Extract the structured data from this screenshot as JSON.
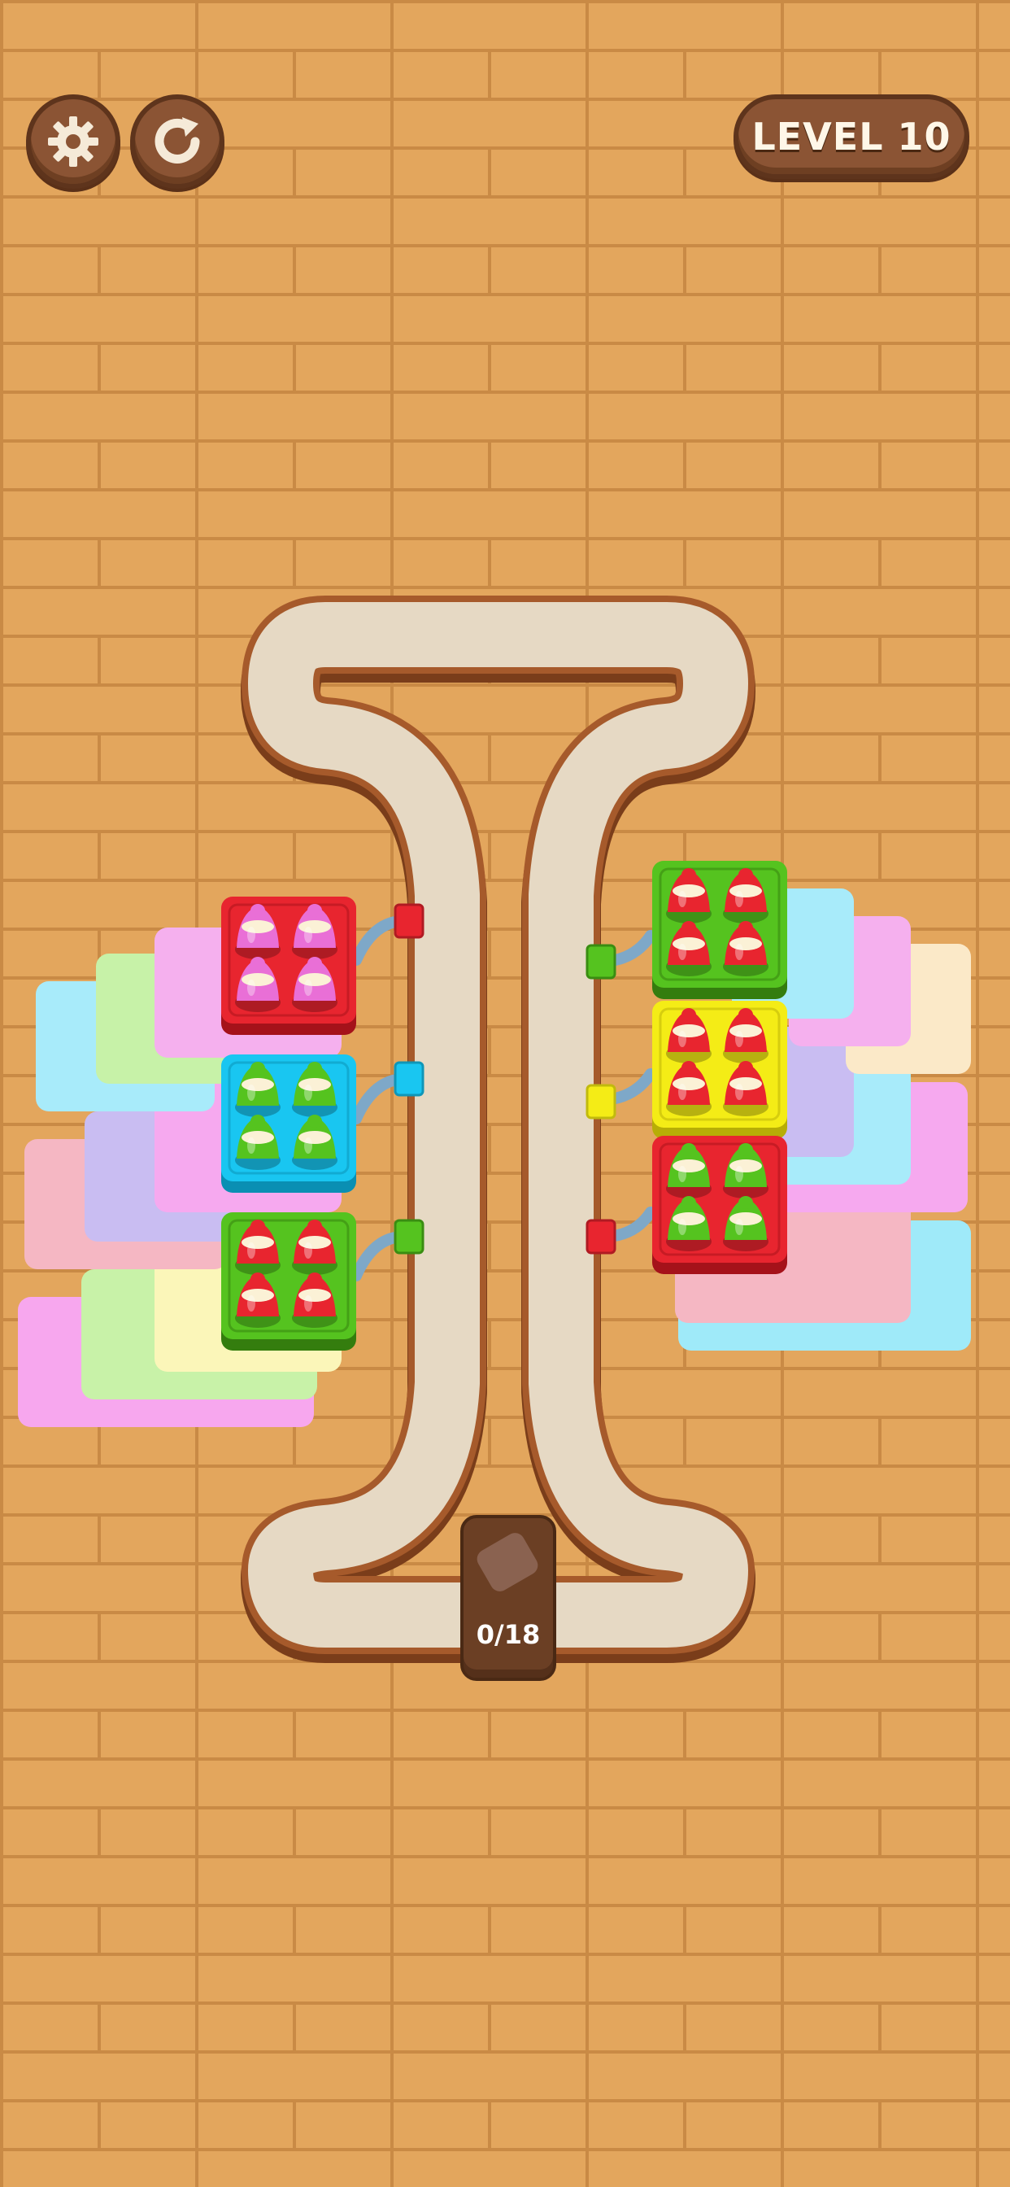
{
  "hud": {
    "settings_icon": "gear-icon",
    "restart_icon": "restart-icon",
    "level_label": "LEVEL 10"
  },
  "conveyor": {
    "counter_text": "0/18"
  },
  "colors": {
    "red": "#e8252f",
    "green": "#55c31f",
    "cyan": "#19c6f1",
    "yellow": "#f4ec16",
    "pink": "#e96fd6",
    "track": "#e5d8c2",
    "track_border": "#8c4a22"
  },
  "left_boxes": [
    {
      "color": "red",
      "pins": [
        "pink",
        "pink",
        "pink",
        "pink"
      ]
    },
    {
      "color": "cyan",
      "pins": [
        "green",
        "green",
        "green",
        "green"
      ]
    },
    {
      "color": "green",
      "pins": [
        "red",
        "red",
        "red",
        "red"
      ]
    }
  ],
  "right_boxes": [
    {
      "color": "green",
      "pins": [
        "red",
        "red",
        "red",
        "red"
      ]
    },
    {
      "color": "yellow",
      "pins": [
        "red",
        "red",
        "red",
        "red"
      ]
    },
    {
      "color": "red",
      "pins": [
        "green",
        "green",
        "green",
        "green"
      ]
    }
  ]
}
